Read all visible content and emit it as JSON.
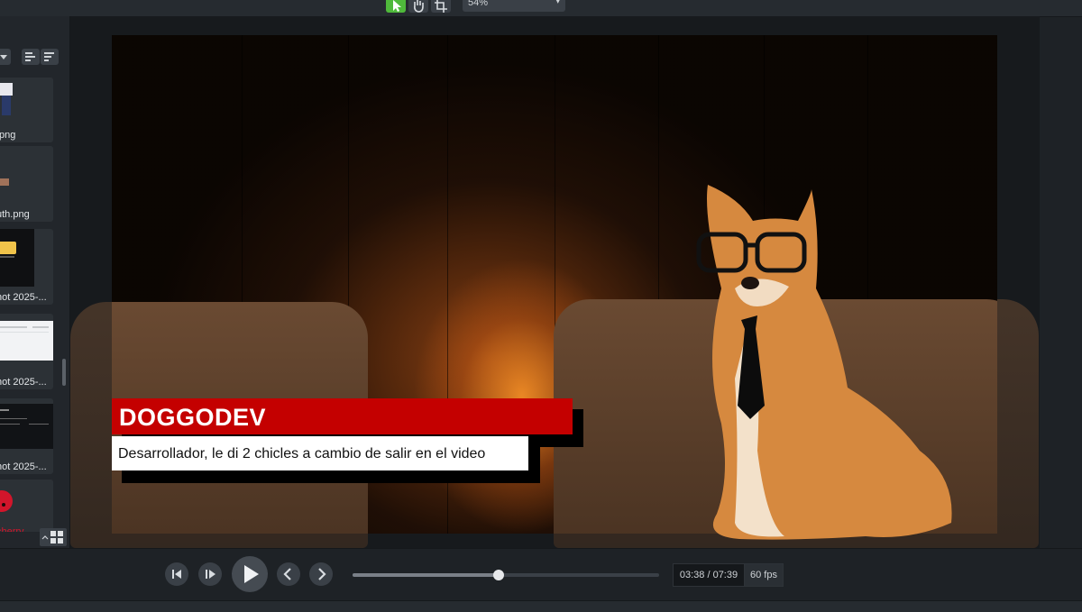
{
  "toolbar": {
    "zoom_value": "54%",
    "tools": [
      "select-arrow-icon",
      "pan-hand-icon",
      "crop-icon"
    ],
    "accent": "#4fb93b"
  },
  "media_bin": {
    "items": [
      {
        "caption": ".png"
      },
      {
        "caption": "uth.png"
      },
      {
        "caption": "hot 2025-..."
      },
      {
        "caption": "hot 2025-..."
      },
      {
        "caption": "hot 2025-..."
      },
      {
        "caption": "cherry"
      }
    ]
  },
  "lower_third": {
    "name": "DOGGODEV",
    "role": "Desarrollador, le di 2 chicles a cambio de salir en el video",
    "name_bar_color": "#c40000"
  },
  "player": {
    "time": "03:38 / 07:39",
    "fps": "60 fps",
    "progress": 0.477
  }
}
